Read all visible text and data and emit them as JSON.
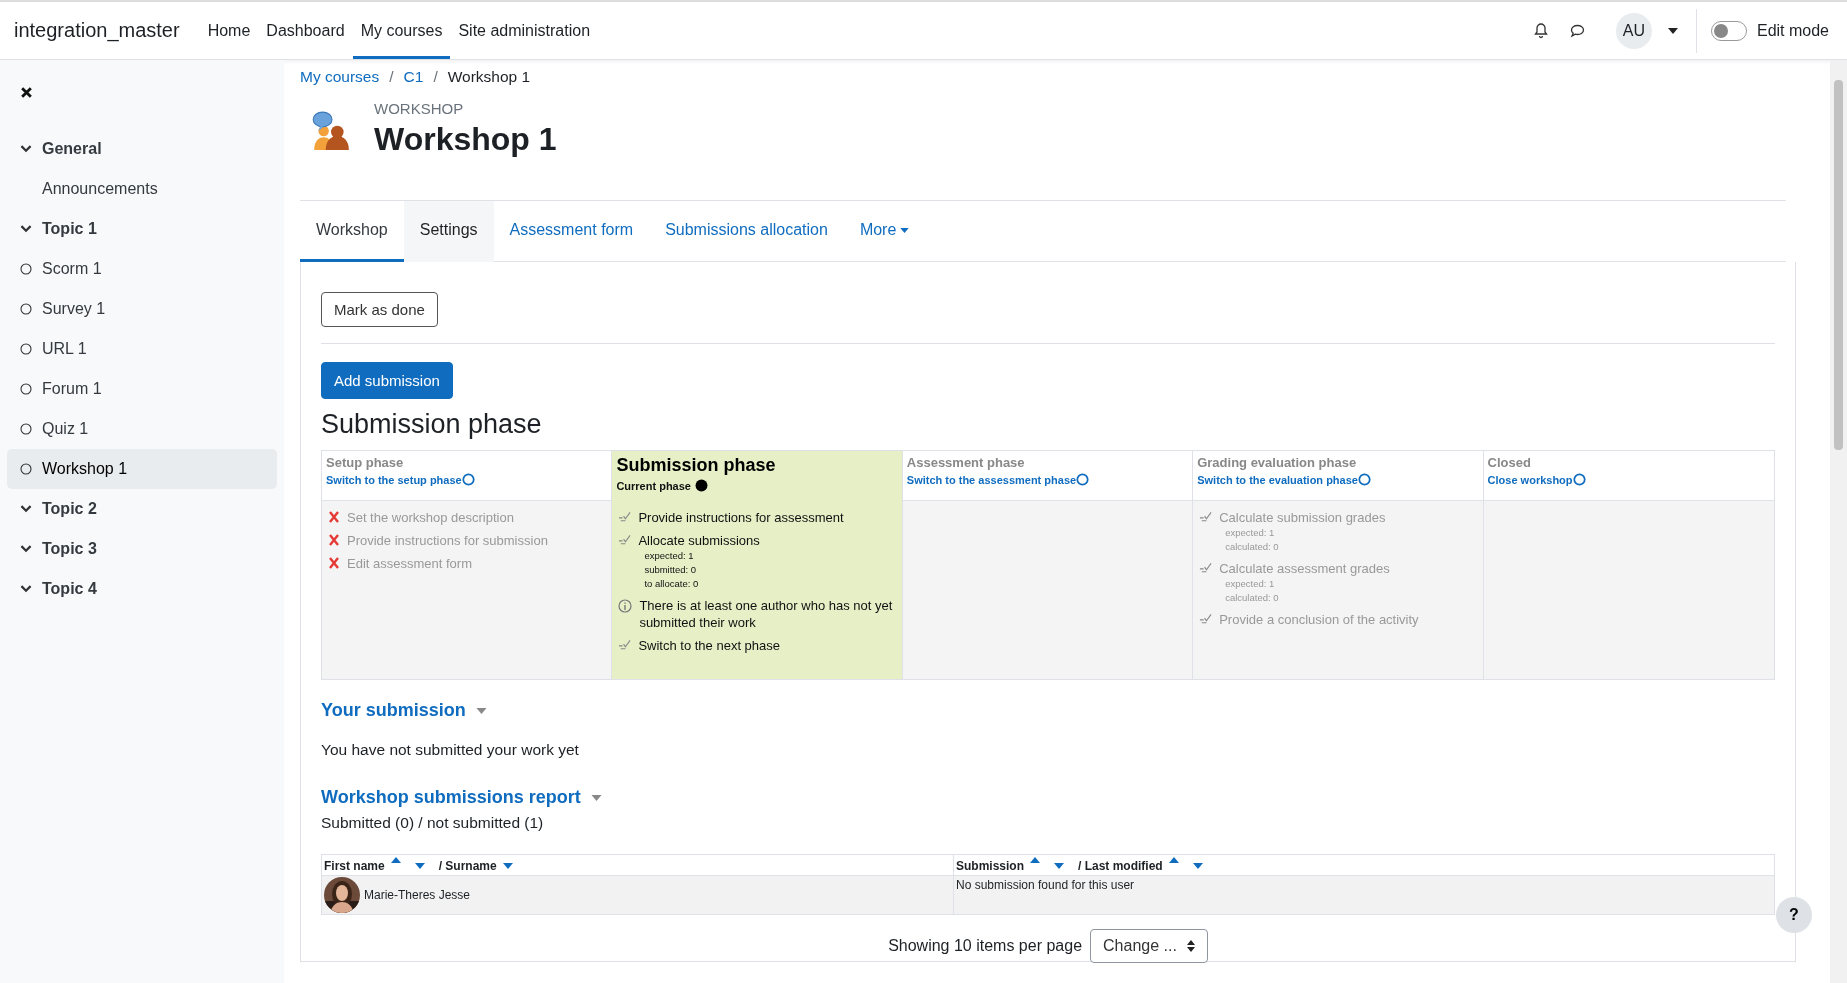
{
  "navbar": {
    "site_name": "integration_master",
    "links": [
      {
        "label": "Home",
        "selected": false
      },
      {
        "label": "Dashboard",
        "selected": false
      },
      {
        "label": "My courses",
        "selected": true
      },
      {
        "label": "Site administration",
        "selected": false
      }
    ],
    "avatar": "AU",
    "edit_mode": {
      "label": "Edit mode",
      "on": false
    }
  },
  "sidebar": {
    "items": [
      {
        "label": "General",
        "kind": "section",
        "expanded": true,
        "selected": false,
        "children": [
          {
            "label": "Announcements",
            "kind": "page",
            "selected": false
          }
        ]
      },
      {
        "label": "Topic 1",
        "kind": "section",
        "expanded": true,
        "selected": false,
        "children": [
          {
            "label": "Scorm 1",
            "kind": "activity",
            "selected": false
          },
          {
            "label": "Survey 1",
            "kind": "activity",
            "selected": false
          },
          {
            "label": "URL 1",
            "kind": "activity",
            "selected": false
          },
          {
            "label": "Forum 1",
            "kind": "activity",
            "selected": false
          },
          {
            "label": "Quiz 1",
            "kind": "activity",
            "selected": false
          },
          {
            "label": "Workshop 1",
            "kind": "activity",
            "selected": true
          }
        ]
      },
      {
        "label": "Topic 2",
        "kind": "section",
        "expanded": true,
        "selected": false
      },
      {
        "label": "Topic 3",
        "kind": "section",
        "expanded": true,
        "selected": false
      },
      {
        "label": "Topic 4",
        "kind": "section",
        "expanded": true,
        "selected": false
      }
    ]
  },
  "breadcrumb": [
    {
      "label": "My courses",
      "link": true
    },
    {
      "separator": "/",
      "label": "C1",
      "link": true
    },
    {
      "separator": "/",
      "label": "Workshop 1",
      "link": false
    }
  ],
  "header": {
    "kicker": "WORKSHOP",
    "title": "Workshop 1"
  },
  "tabs": [
    {
      "label": "Workshop",
      "selected": true,
      "hover": false
    },
    {
      "label": "Settings",
      "selected": false,
      "hover": true
    },
    {
      "label": "Assessment form",
      "selected": false,
      "hover": false
    },
    {
      "label": "Submissions allocation",
      "selected": false,
      "hover": false
    },
    {
      "label": "More",
      "selected": false,
      "hover": false
    }
  ],
  "mark_done": "Mark as done",
  "add_submission": "Add submission",
  "phase_heading": "Submission phase",
  "phases": [
    {
      "title": "Setup phase",
      "current": false,
      "link": "Switch to the setup phase",
      "tasks": [
        {
          "kind": "fail",
          "text": "Set the workshop description"
        },
        {
          "kind": "fail",
          "text": "Provide instructions for submission"
        },
        {
          "kind": "fail",
          "text": "Edit assessment form"
        }
      ]
    },
    {
      "title": "Submission phase",
      "current": true,
      "link": "Current phase",
      "tasks": [
        {
          "kind": "todo",
          "text": "Provide instructions for assessment"
        },
        {
          "kind": "todo",
          "text": "Allocate submissions",
          "details": [
            "expected: 1",
            "submitted: 0",
            "to allocate: 0"
          ]
        },
        {
          "kind": "info",
          "text": "There is at least one author who has not yet submitted their work"
        },
        {
          "kind": "todo",
          "text": "Switch to the next phase"
        }
      ]
    },
    {
      "title": "Assessment phase",
      "current": false,
      "link": "Switch to the assessment phase"
    },
    {
      "title": "Grading evaluation phase",
      "current": false,
      "link": "Switch to the evaluation phase",
      "tasks": [
        {
          "kind": "todo",
          "text": "Calculate submission grades",
          "details": [
            "expected: 1",
            "calculated: 0"
          ]
        },
        {
          "kind": "todo",
          "text": "Calculate assessment grades",
          "details": [
            "expected: 1",
            "calculated: 0"
          ]
        },
        {
          "kind": "todo",
          "text": "Provide a conclusion of the activity"
        }
      ]
    },
    {
      "title": "Closed",
      "current": false,
      "link": "Close workshop"
    }
  ],
  "your_submission": {
    "heading": "Your submission",
    "text": "You have not submitted your work yet"
  },
  "report": {
    "heading": "Workshop submissions report",
    "summary": "Submitted (0) / not submitted (1)",
    "columns": [
      "First name",
      "/ Surname",
      "Submission",
      "/ Last modified"
    ],
    "rows": [
      {
        "name": "Marie-Theres Jesse",
        "submission": "No submission found for this user"
      }
    ]
  },
  "paging": {
    "text": "Showing 10 items per page",
    "select": "Change ..."
  },
  "help": "?"
}
